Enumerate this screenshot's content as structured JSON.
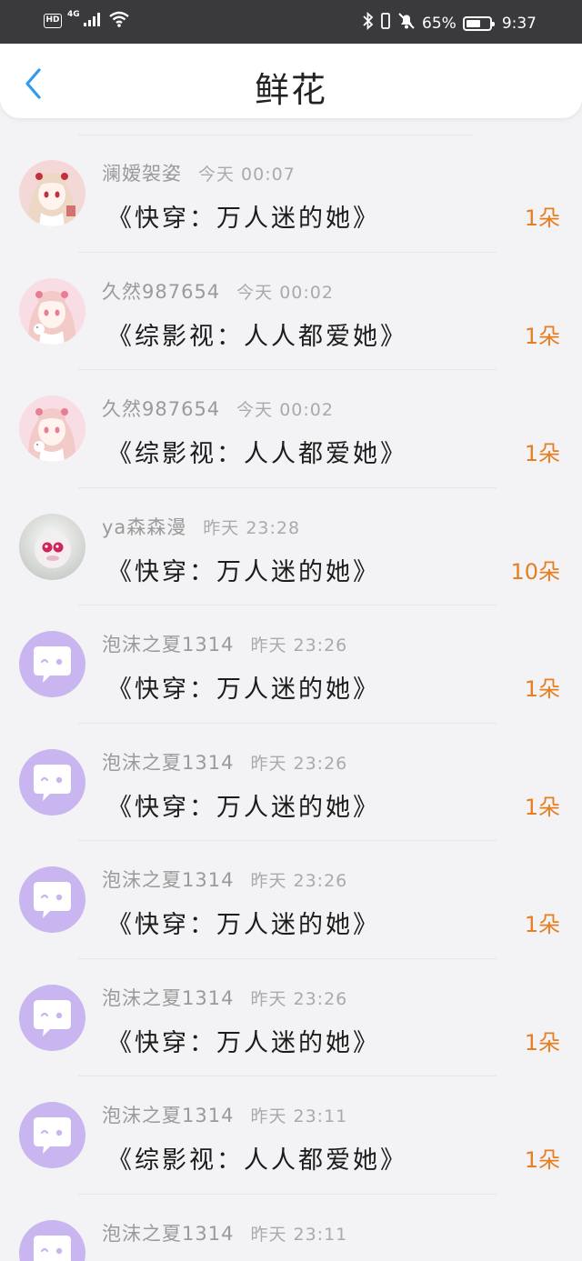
{
  "status_bar": {
    "hd": "HD",
    "network": "4G",
    "battery_text": "65%",
    "battery_level": 0.65,
    "time": "9:37",
    "icons": [
      "hd-icon",
      "signal-icon",
      "wifi-icon",
      "bluetooth-icon",
      "vibrate-icon",
      "mute-icon",
      "battery-icon"
    ]
  },
  "header": {
    "title": "鲜花",
    "back_icon": "chevron-left-icon",
    "accent_color": "#2d9cf0"
  },
  "colors": {
    "count": "#e67e22",
    "default_avatar_bg": "#c9b6f0"
  },
  "items": [
    {
      "user": "澜嫒袈姿",
      "time": "今天 00:07",
      "book": "《快穿：万人迷的她》",
      "count": "1朵",
      "avatar": "anime-girl-red-avatar"
    },
    {
      "user": "久然987654",
      "time": "今天 00:02",
      "book": "《综影视：人人都爱她》",
      "count": "1朵",
      "avatar": "anime-girl-pink-avatar"
    },
    {
      "user": "久然987654",
      "time": "今天 00:02",
      "book": "《综影视：人人都爱她》",
      "count": "1朵",
      "avatar": "anime-girl-pink-avatar"
    },
    {
      "user": "ya森森漫",
      "time": "昨天 23:28",
      "book": "《快穿：万人迷的她》",
      "count": "10朵",
      "avatar": "fluffy-creature-avatar"
    },
    {
      "user": "泡沫之夏1314",
      "time": "昨天 23:26",
      "book": "《快穿：万人迷的她》",
      "count": "1朵",
      "avatar": "default-chat-avatar"
    },
    {
      "user": "泡沫之夏1314",
      "time": "昨天 23:26",
      "book": "《快穿：万人迷的她》",
      "count": "1朵",
      "avatar": "default-chat-avatar"
    },
    {
      "user": "泡沫之夏1314",
      "time": "昨天 23:26",
      "book": "《快穿：万人迷的她》",
      "count": "1朵",
      "avatar": "default-chat-avatar"
    },
    {
      "user": "泡沫之夏1314",
      "time": "昨天 23:26",
      "book": "《快穿：万人迷的她》",
      "count": "1朵",
      "avatar": "default-chat-avatar"
    },
    {
      "user": "泡沫之夏1314",
      "time": "昨天 23:11",
      "book": "《综影视：人人都爱她》",
      "count": "1朵",
      "avatar": "default-chat-avatar"
    },
    {
      "user": "泡沫之夏1314",
      "time": "昨天 23:11",
      "book": "",
      "count": "",
      "avatar": "default-chat-avatar"
    }
  ]
}
